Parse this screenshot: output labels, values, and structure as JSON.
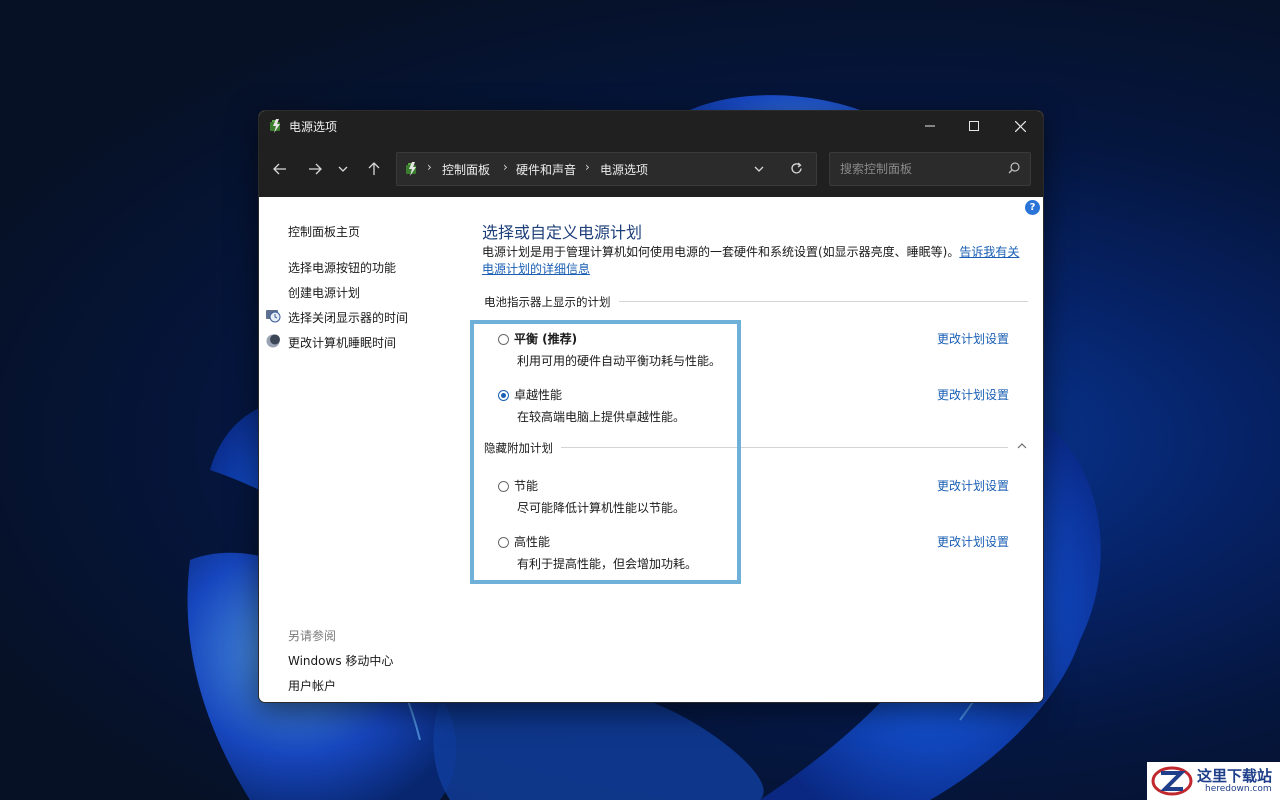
{
  "window": {
    "title": "电源选项"
  },
  "address_bar": {
    "crumbs": [
      "控制面板",
      "硬件和声音",
      "电源选项"
    ]
  },
  "search": {
    "placeholder": "搜索控制面板"
  },
  "sidebar": {
    "home": "控制面板主页",
    "links": [
      "选择电源按钮的功能",
      "创建电源计划",
      "选择关闭显示器的时间",
      "更改计算机睡眠时间"
    ],
    "see_also_header": "另请参阅",
    "see_also": [
      "Windows 移动中心",
      "用户帐户"
    ]
  },
  "main": {
    "title": "选择或自定义电源计划",
    "description": "电源计划是用于管理计算机如何使用电源的一套硬件和系统设置(如显示器亮度、睡眠等)。",
    "description_link": "告诉我有关电源计划的详细信息",
    "battery_group_label": "电池指示器上显示的计划",
    "hidden_group_label": "隐藏附加计划",
    "change_link": "更改计划设置",
    "plans": [
      {
        "name": "平衡 (推荐)",
        "desc": "利用可用的硬件自动平衡功耗与性能。",
        "selected": false
      },
      {
        "name": "卓越性能",
        "desc": "在较高端电脑上提供卓越性能。",
        "selected": true
      },
      {
        "name": "节能",
        "desc": "尽可能降低计算机性能以节能。",
        "selected": false
      },
      {
        "name": "高性能",
        "desc": "有利于提高性能，但会增加功耗。",
        "selected": false
      }
    ]
  },
  "watermark": {
    "name": "这里下载站",
    "url": "heredown.com"
  },
  "colors": {
    "accent": "#1a5fb4",
    "title_blue": "#1e3f7a",
    "highlight_box": "#6fb0d9",
    "titlebar": "#202020"
  }
}
